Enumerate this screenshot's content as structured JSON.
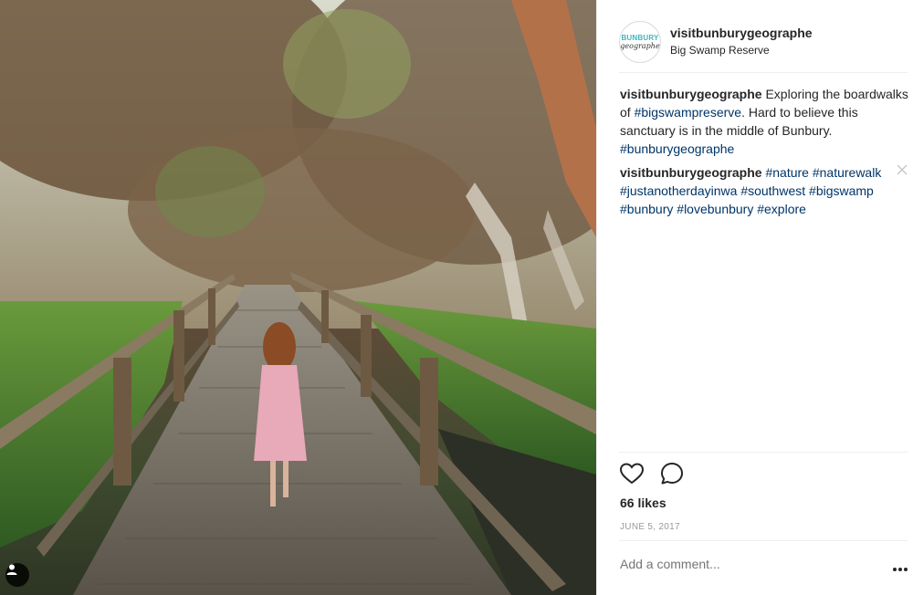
{
  "post": {
    "username": "visitbunburygeographe",
    "location": "Big Swamp Reserve",
    "avatar_text_line1": "BUNBURY",
    "avatar_text_line2": "geographe",
    "comments": [
      {
        "user": "visitbunburygeographe",
        "parts": [
          {
            "text": " Exploring the boardwalks of ",
            "tag": false
          },
          {
            "text": "#bigswampreserve",
            "tag": true
          },
          {
            "text": ". Hard to believe this sanctuary is in the middle of Bunbury. ",
            "tag": false
          },
          {
            "text": "#bunburygeographe",
            "tag": true
          }
        ]
      },
      {
        "user": "visitbunburygeographe",
        "parts": [
          {
            "text": " ",
            "tag": false
          },
          {
            "text": "#nature",
            "tag": true
          },
          {
            "text": " ",
            "tag": false
          },
          {
            "text": "#naturewalk",
            "tag": true
          },
          {
            "text": " ",
            "tag": false
          },
          {
            "text": "#justanotherdayinwa",
            "tag": true
          },
          {
            "text": " ",
            "tag": false
          },
          {
            "text": "#southwest",
            "tag": true
          },
          {
            "text": " ",
            "tag": false
          },
          {
            "text": "#bigswamp",
            "tag": true
          },
          {
            "text": " ",
            "tag": false
          },
          {
            "text": "#bunbury",
            "tag": true
          },
          {
            "text": " ",
            "tag": false
          },
          {
            "text": "#lovebunbury",
            "tag": true
          },
          {
            "text": " ",
            "tag": false
          },
          {
            "text": "#explore",
            "tag": true
          }
        ]
      }
    ],
    "likes": "66 likes",
    "date": "JUNE 5, 2017",
    "comment_placeholder": "Add a comment...",
    "icons": [
      "heart-icon",
      "comment-icon",
      "close-icon",
      "more-options-icon",
      "user-tag-icon"
    ]
  },
  "colors": {
    "hashtag": "#003569",
    "text": "#262626",
    "muted": "#999999",
    "divider": "#efefef",
    "avatar_accent": "#3fb5c0"
  }
}
